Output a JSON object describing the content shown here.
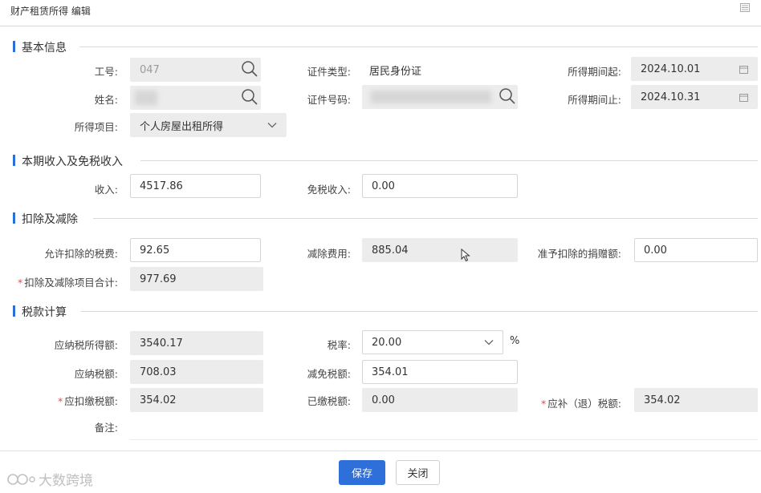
{
  "window": {
    "title": "财产租赁所得 编辑"
  },
  "sections": {
    "basic": "基本信息",
    "income": "本期收入及免税收入",
    "deduction": "扣除及减除",
    "tax": "税款计算"
  },
  "basic": {
    "emp_no_label": "工号:",
    "emp_no_value": "047",
    "name_label": "姓名:",
    "income_item_label": "所得项目:",
    "income_item_value": "个人房屋出租所得",
    "id_type_label": "证件类型:",
    "id_type_value": "居民身份证",
    "id_no_label": "证件号码:",
    "period_start_label": "所得期间起:",
    "period_start_value": "2024.10.01",
    "period_end_label": "所得期间止:",
    "period_end_value": "2024.10.31"
  },
  "income": {
    "income_label": "收入:",
    "income_value": "4517.86",
    "tax_free_label": "免税收入:",
    "tax_free_value": "0.00"
  },
  "deduction": {
    "allowed_tax_label": "允许扣除的税费:",
    "allowed_tax_value": "92.65",
    "reduction_label": "减除费用:",
    "reduction_value": "885.04",
    "donation_label": "准予扣除的捐赠额:",
    "donation_value": "0.00",
    "total_label": "扣除及减除项目合计:",
    "total_value": "977.69"
  },
  "tax": {
    "taxable_label": "应纳税所得额:",
    "taxable_value": "3540.17",
    "rate_label": "税率:",
    "rate_value": "20.00",
    "rate_unit": "%",
    "tax_payable_label": "应纳税额:",
    "tax_payable_value": "708.03",
    "tax_relief_label": "减免税额:",
    "tax_relief_value": "354.01",
    "withhold_label": "应扣缴税额:",
    "withhold_value": "354.02",
    "paid_label": "已缴税额:",
    "paid_value": "0.00",
    "refund_label": "应补（退）税额:",
    "refund_value": "354.02",
    "remark_label": "备注:"
  },
  "footer": {
    "save_label": "保存",
    "close_label": "关闭"
  },
  "watermark": {
    "text": "大数跨境"
  },
  "colors": {
    "accent": "#2f6fd9",
    "required": "#e84a4a",
    "readonly_bg": "#ececec"
  }
}
